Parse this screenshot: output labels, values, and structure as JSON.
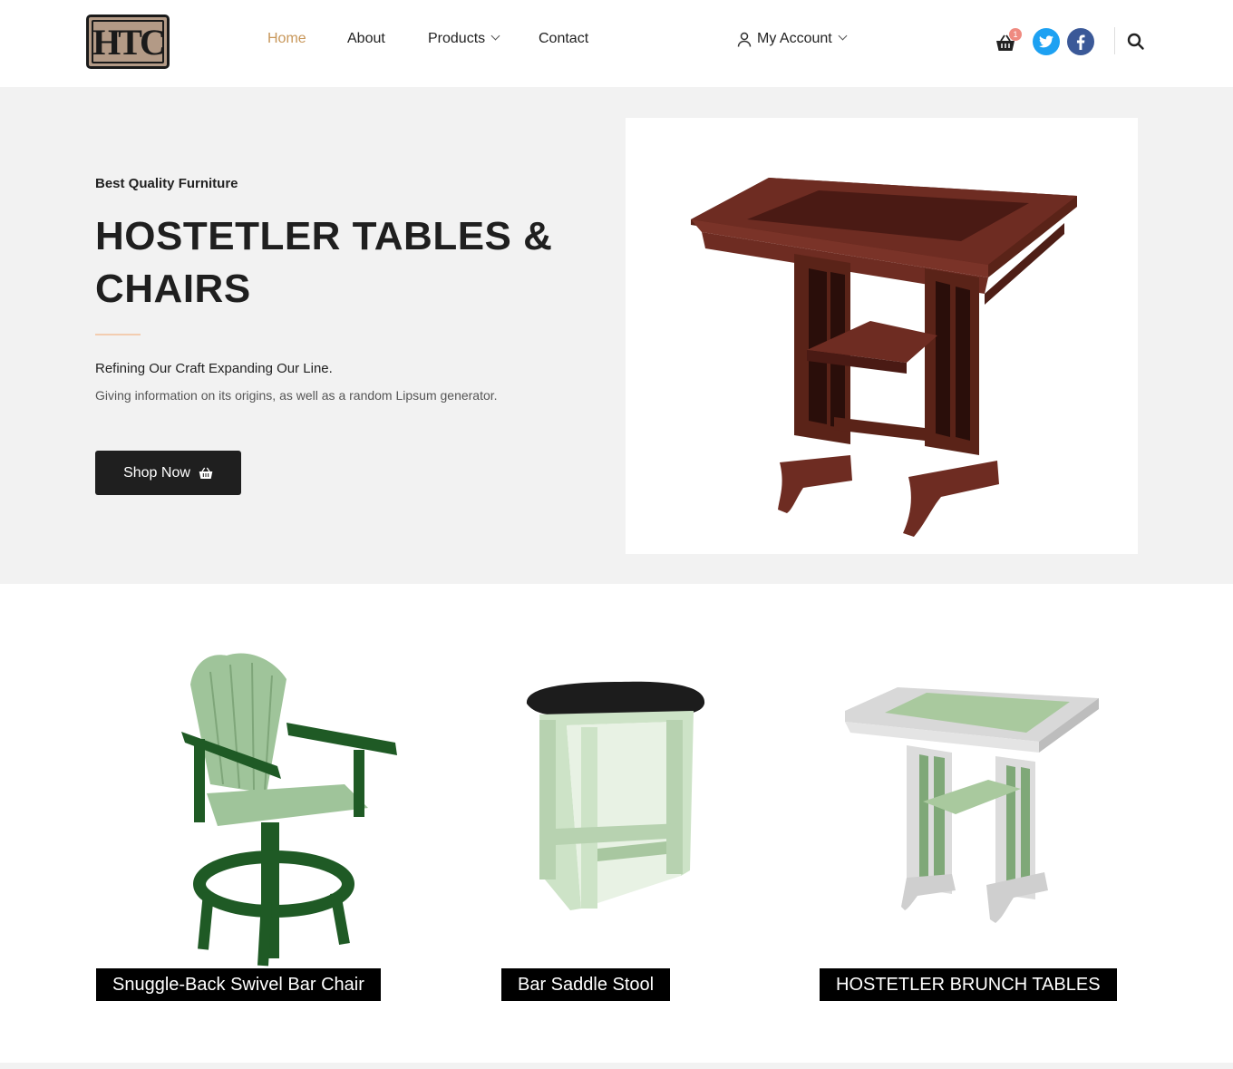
{
  "header": {
    "logo_text": "HTC",
    "nav": [
      {
        "label": "Home",
        "active": true
      },
      {
        "label": "About"
      },
      {
        "label": "Products",
        "has_dropdown": true
      },
      {
        "label": "Contact"
      }
    ],
    "account_label": "My Account",
    "cart_count": "1",
    "icons": [
      "user-icon",
      "cart-icon",
      "twitter-icon",
      "facebook-icon",
      "search-icon"
    ]
  },
  "hero": {
    "kicker": "Best Quality Furniture",
    "title": "HOSTETLER TABLES & CHAIRS",
    "subtitle": "Refining Our Craft Expanding Our Line.",
    "description": "Giving information on its origins, as well as a random Lipsum generator.",
    "button_label": "Shop Now"
  },
  "products": [
    {
      "label": "Snuggle-Back Swivel Bar Chair"
    },
    {
      "label": "Bar Saddle Stool"
    },
    {
      "label": "HOSTETLER BRUNCH TABLES"
    }
  ],
  "colors": {
    "accent": "#c8975a",
    "dark": "#1f1f1f",
    "hero_bg": "#f2f2f2",
    "twitter": "#1da1f2",
    "facebook": "#3b5998"
  }
}
